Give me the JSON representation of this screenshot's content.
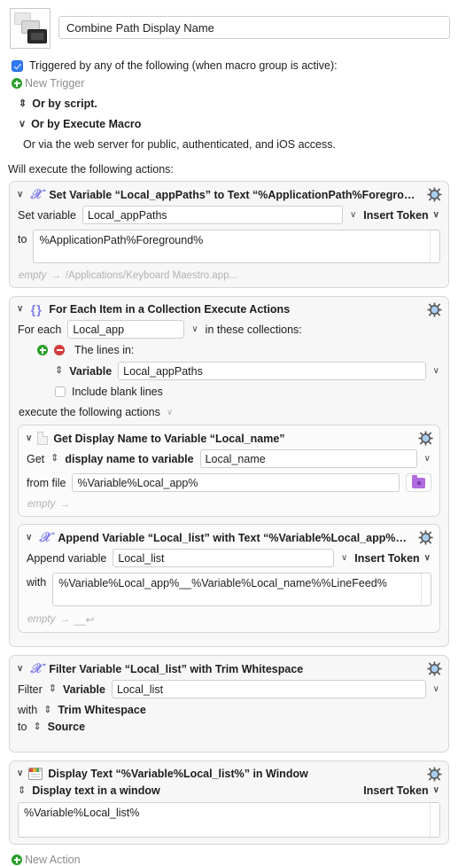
{
  "macro": {
    "icon_name": "macro-stacked-windows-icon",
    "name": "Combine Path Display Name"
  },
  "trigger": {
    "checkbox_label": "Triggered by any of the following (when macro group is active):",
    "new_trigger_label": "New Trigger",
    "or_script": "Or by script.",
    "or_execute_macro": "Or by Execute Macro",
    "or_web_server": "Or via the web server for public, authenticated, and iOS access."
  },
  "will_execute_label": "Will execute the following actions:",
  "new_action_label": "New Action",
  "actions": [
    {
      "title": "Set Variable “Local_appPaths” to Text “%ApplicationPath%Foreground%”",
      "icon": "x-variable-icon",
      "set_variable_label": "Set variable",
      "variable_value": "Local_appPaths",
      "insert_token_label": "Insert Token",
      "to_label": "to",
      "text_value": "%ApplicationPath%Foreground%",
      "hint_empty": "empty",
      "hint_arrow": "→",
      "hint_value": "/Applications/Keyboard Maestro.app..."
    },
    {
      "title": "For Each Item in a Collection Execute Actions",
      "icon": "braces-icon",
      "for_each_label": "For each",
      "for_each_value": "Local_app",
      "in_collections_label": "in these collections:",
      "the_lines_in_label": "The lines in:",
      "variable_label": "Variable",
      "variable_value": "Local_appPaths",
      "include_blank_label": "Include blank lines",
      "execute_label": "execute the following actions"
    },
    {
      "title": "Get Display Name to Variable “Local_name”",
      "icon": "document-icon",
      "get_label": "Get",
      "get_kind": "display name to variable",
      "variable_value": "Local_name",
      "from_file_label": "from file",
      "from_file_value": "%Variable%Local_app%",
      "folder_icon": "folder-icon",
      "hint_empty": "empty",
      "hint_arrow": "→"
    },
    {
      "title": "Append Variable “Local_list” with Text “%Variable%Local_app%__…",
      "icon": "x-variable-icon",
      "append_label": "Append variable",
      "variable_value": "Local_list",
      "insert_token_label": "Insert Token",
      "with_label": "with",
      "text_value": "%Variable%Local_app%__%Variable%Local_name%%LineFeed%",
      "hint_empty": "empty",
      "hint_arrow": "→",
      "hint_value": "__↩"
    },
    {
      "title": "Filter Variable “Local_list” with Trim Whitespace",
      "icon": "x-variable-icon",
      "filter_label": "Filter",
      "filter_kind": "Variable",
      "variable_value": "Local_list",
      "with_label": "with",
      "with_kind": "Trim Whitespace",
      "to_label": "to",
      "to_kind": "Source"
    },
    {
      "title": "Display Text “%Variable%Local_list%” in Window",
      "icon": "window-icon",
      "display_kind": "Display text in a window",
      "insert_token_label": "Insert Token",
      "text_value": "%Variable%Local_list%"
    }
  ],
  "glyphs": {
    "disclosure_open": "∨",
    "updown": "⇕",
    "chevron_down": "∨",
    "gear_icon": "gear-icon"
  },
  "colors": {
    "accent_blue": "#2f7bf5",
    "icon_purple": "#7b7bea",
    "green_add": "#2aa02a",
    "red_remove": "#d33c3c",
    "folder_purple": "#b06be0",
    "gear_center": "#a8cdf0"
  }
}
